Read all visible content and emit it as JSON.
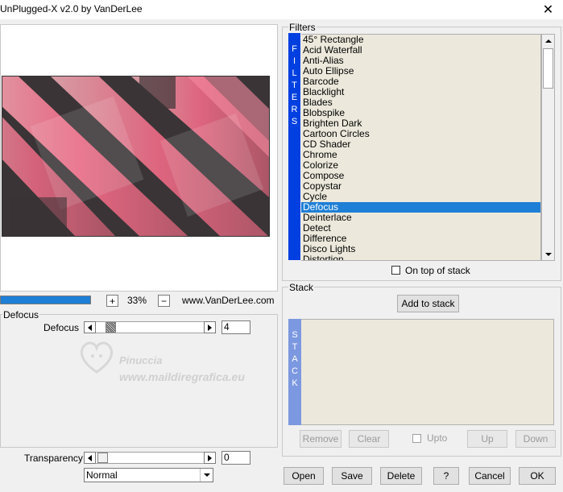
{
  "window": {
    "title": "UnPlugged-X v2.0 by VanDerLee",
    "close_glyph": "✕"
  },
  "preview": {
    "zoom_plus": "+",
    "zoom_value": "33%",
    "zoom_minus": "−",
    "website": "www.VanDerLee.com",
    "progress_fraction": 1.0
  },
  "params": {
    "legend": "Defocus",
    "defocus_label": "Defocus",
    "defocus_value": "4",
    "transparency_label": "Transparency",
    "transparency_value": "0",
    "blend_mode": "Normal"
  },
  "filters": {
    "legend": "Filters",
    "tab_letters": [
      "F",
      "I",
      "L",
      "T",
      "E",
      "R",
      "S"
    ],
    "selected_index": 16,
    "items": [
      "45° Rectangle",
      "Acid Waterfall",
      "Anti-Alias",
      "Auto Ellipse",
      "Barcode",
      "Blacklight",
      "Blades",
      "Blobspike",
      "Brighten Dark",
      "Cartoon Circles",
      "CD Shader",
      "Chrome",
      "Colorize",
      "Compose",
      "Copystar",
      "Cycle",
      "Defocus",
      "Deinterlace",
      "Detect",
      "Difference",
      "Disco Lights",
      "Distortion"
    ],
    "on_top_label": "On top of stack"
  },
  "stack": {
    "legend": "Stack",
    "add_label": "Add to stack",
    "tab_letters": [
      "S",
      "T",
      "A",
      "C",
      "K"
    ],
    "remove_label": "Remove",
    "clear_label": "Clear",
    "upto_label": "Upto",
    "up_label": "Up",
    "down_label": "Down"
  },
  "buttons": {
    "open": "Open",
    "save": "Save",
    "delete": "Delete",
    "help": "?",
    "cancel": "Cancel",
    "ok": "OK"
  },
  "watermark": {
    "name": "Pinuccia",
    "site": "www.maildiregrafica.eu"
  },
  "colors": {
    "accent_blue": "#1e7fd6",
    "filters_tab": "#0040e0",
    "stack_tab": "#7c98e0",
    "list_bg": "#ece9dc"
  }
}
